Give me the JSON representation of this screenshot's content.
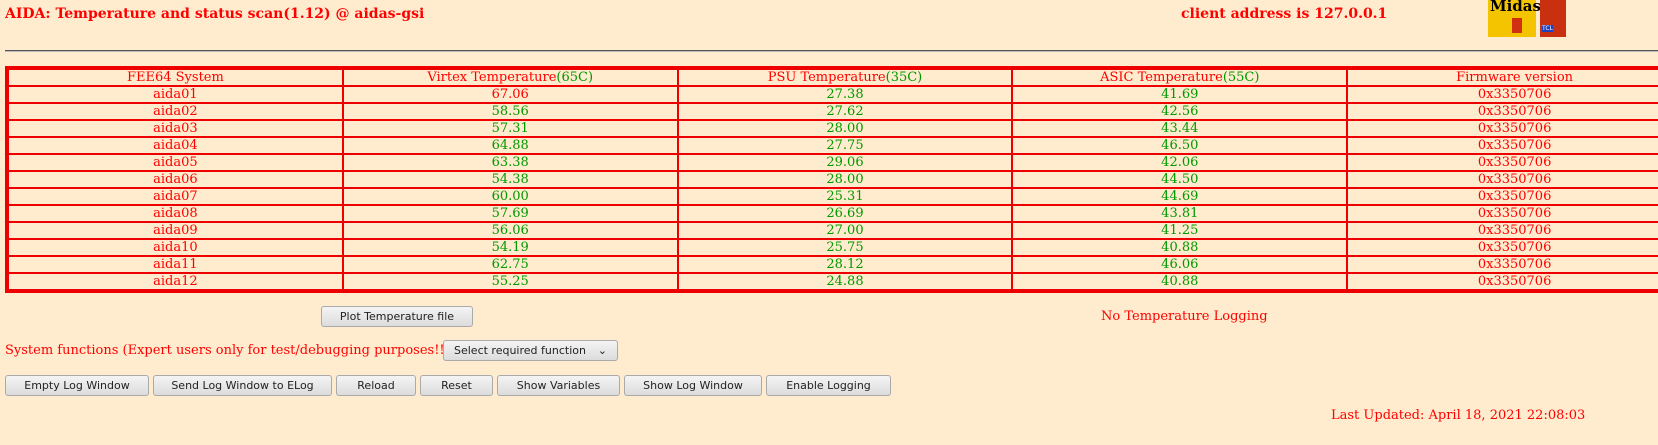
{
  "header": {
    "title": "AIDA: Temperature and status scan(1.12) @ aidas-gsi",
    "client": "client address is 127.0.0.1",
    "logo_text": "Midas",
    "logo2_text": "TCL"
  },
  "table": {
    "headers": [
      {
        "label": "FEE64 System"
      },
      {
        "label": "Virtex Temperature",
        "limit": "(65C)"
      },
      {
        "label": "PSU Temperature",
        "limit": "(35C)"
      },
      {
        "label": "ASIC Temperature",
        "limit": "(55C)"
      },
      {
        "label": "Firmware version"
      }
    ],
    "rows": [
      [
        "aida01",
        "67.06",
        "27.38",
        "41.69",
        "0x3350706"
      ],
      [
        "aida02",
        "58.56",
        "27.62",
        "42.56",
        "0x3350706"
      ],
      [
        "aida03",
        "57.31",
        "28.00",
        "43.44",
        "0x3350706"
      ],
      [
        "aida04",
        "64.88",
        "27.75",
        "46.50",
        "0x3350706"
      ],
      [
        "aida05",
        "63.38",
        "29.06",
        "42.06",
        "0x3350706"
      ],
      [
        "aida06",
        "54.38",
        "28.00",
        "44.50",
        "0x3350706"
      ],
      [
        "aida07",
        "60.00",
        "25.31",
        "44.69",
        "0x3350706"
      ],
      [
        "aida08",
        "57.69",
        "26.69",
        "43.81",
        "0x3350706"
      ],
      [
        "aida09",
        "56.06",
        "27.00",
        "41.25",
        "0x3350706"
      ],
      [
        "aida10",
        "54.19",
        "25.75",
        "40.88",
        "0x3350706"
      ],
      [
        "aida11",
        "62.75",
        "28.12",
        "46.06",
        "0x3350706"
      ],
      [
        "aida12",
        "55.25",
        "24.88",
        "40.88",
        "0x3350706"
      ]
    ],
    "alarm_cells": [
      "0-1"
    ]
  },
  "plot_button": "Plot Temperature file",
  "logging_status": "No Temperature Logging",
  "system_functions_label": "System functions (Expert users only for test/debugging purposes!!!)",
  "function_select": "Select required function",
  "buttons": [
    "Empty Log Window",
    "Send Log Window to ELog",
    "Reload",
    "Reset",
    "Show Variables",
    "Show Log Window",
    "Enable Logging"
  ],
  "last_updated": "Last Updated: April 18, 2021 22:08:03",
  "colors": {
    "bg": "#ffebcd",
    "text": "#ff0000",
    "ok": "#009900"
  }
}
